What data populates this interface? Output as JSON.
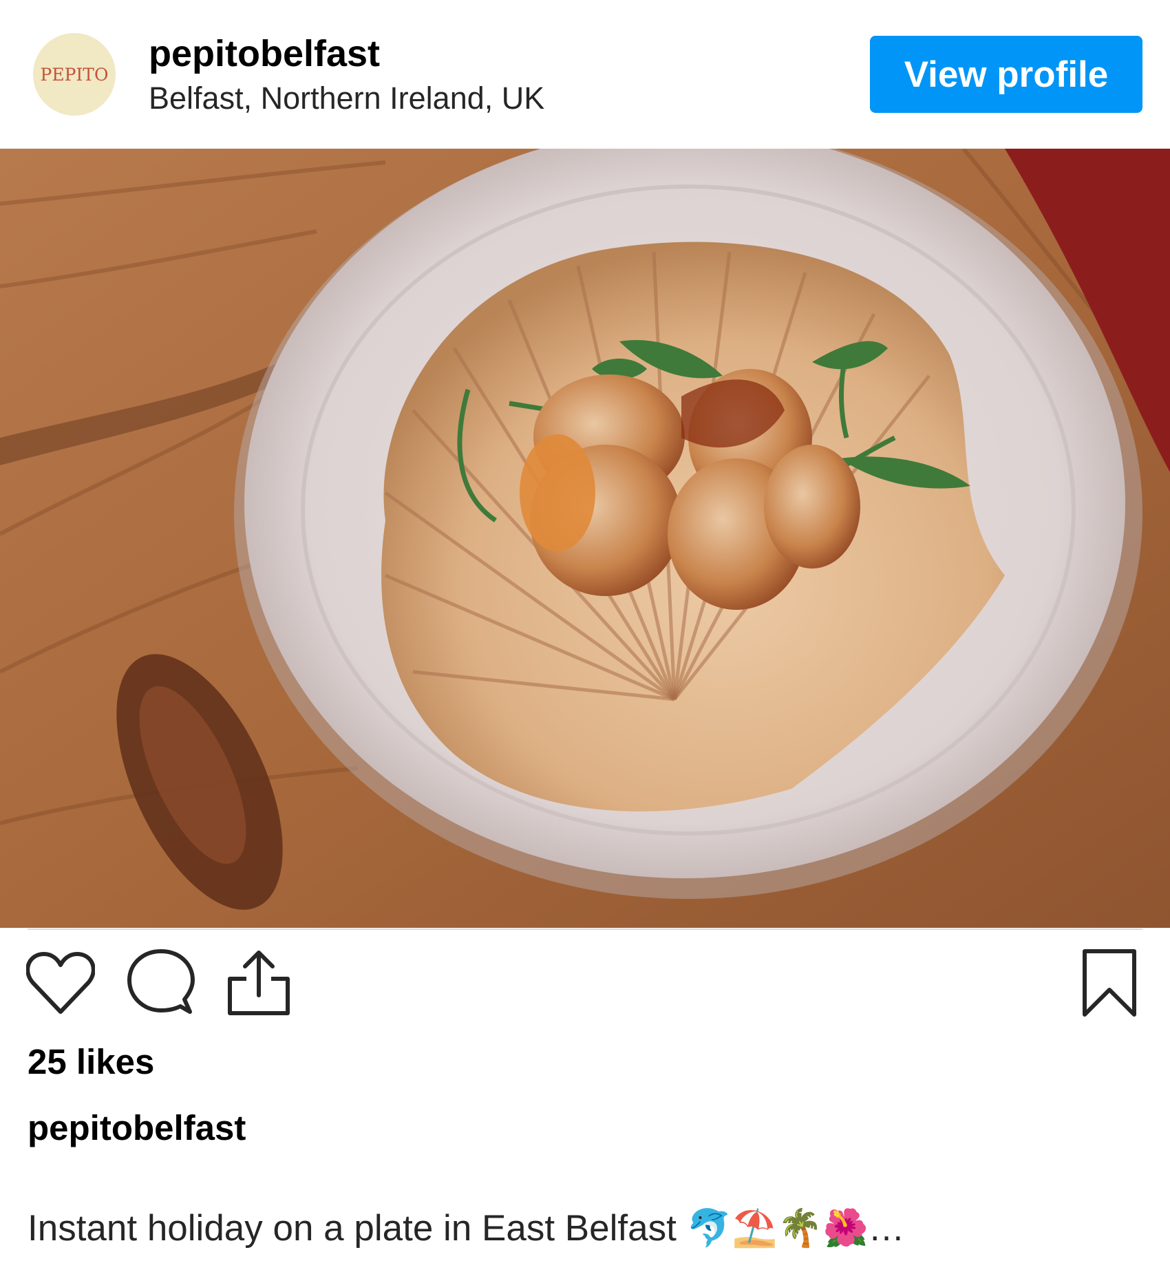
{
  "post": {
    "avatar_text": "PEPITO",
    "username": "pepitobelfast",
    "location": "Belfast, Northern Ireland, UK",
    "view_profile_label": "View profile",
    "photo_alt": "Seared scallops with rocket in a scallop shell on a white plate",
    "likes": "25 likes",
    "caption_username": "pepitobelfast",
    "caption_text": "Instant holiday on a plate in East Belfast 🐬⛱️🌴🌺…"
  },
  "icons": {
    "like": "heart-icon",
    "comment": "comment-bubble-icon",
    "share": "share-upload-icon",
    "save": "bookmark-icon"
  },
  "colors": {
    "accent": "#0095f6",
    "avatar_bg": "#f1e8c4",
    "avatar_text": "#c1543a"
  }
}
